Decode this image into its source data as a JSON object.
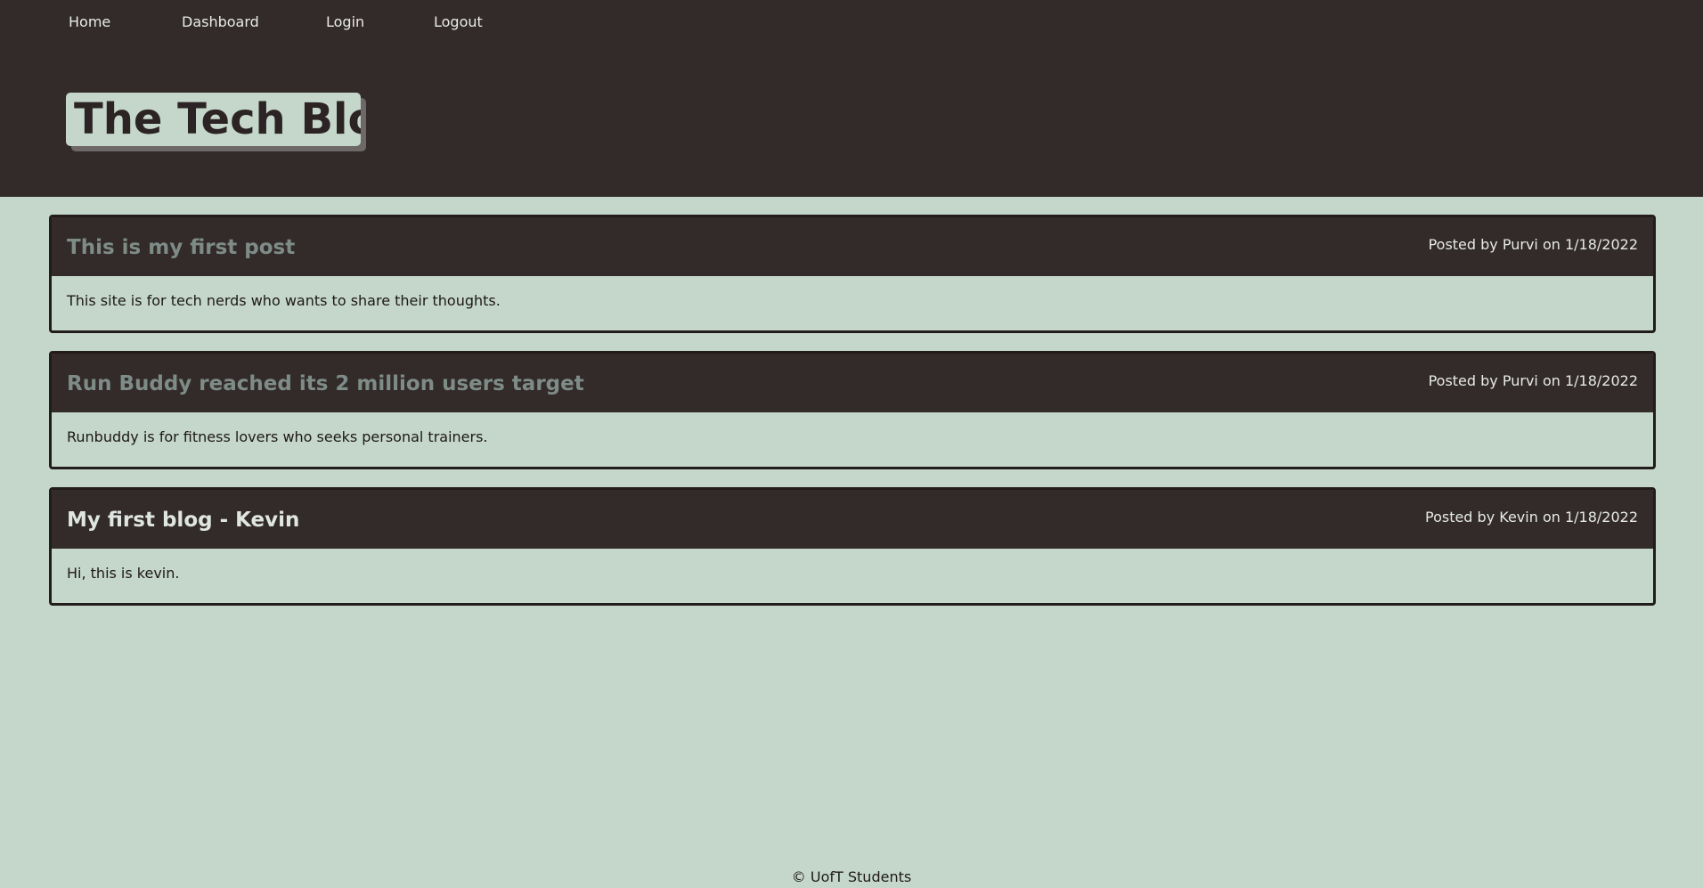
{
  "nav": {
    "items": [
      {
        "label": "Home"
      },
      {
        "label": "Dashboard"
      },
      {
        "label": "Login"
      },
      {
        "label": "Logout"
      }
    ]
  },
  "header": {
    "title": "The Tech Blog"
  },
  "colors": {
    "background": "#c5d7cb",
    "header_bg": "#332a2a",
    "visited_title": "#7e8c87",
    "unvisited_title": "#dfe6e1"
  },
  "posts": [
    {
      "title": "This is my first post",
      "meta": "Posted by Purvi on 1/18/2022",
      "body": "This site is for tech nerds who wants to share their thoughts.",
      "title_color": "#7e8c87"
    },
    {
      "title": "Run Buddy reached its 2 million users target",
      "meta": "Posted by Purvi on 1/18/2022",
      "body": "Runbuddy is for fitness lovers who seeks personal trainers.",
      "title_color": "#7e8c87"
    },
    {
      "title": "My first blog - Kevin",
      "meta": "Posted by Kevin on 1/18/2022",
      "body": "Hi, this is kevin.",
      "title_color": "#dfe6e1"
    }
  ],
  "footer": {
    "text": "© UofT Students"
  }
}
